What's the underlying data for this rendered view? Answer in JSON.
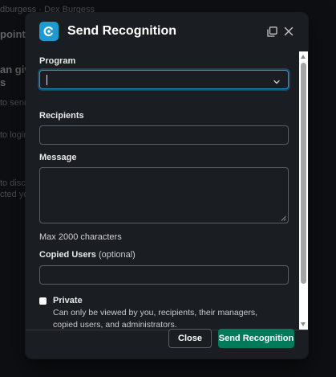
{
  "background": {
    "breadcrumb": "dburgess · Dex Burgess",
    "fragments": [
      "point",
      "an give",
      "s",
      "to send",
      "to login",
      "to disco",
      "cted you"
    ]
  },
  "modal": {
    "title": "Send Recognition",
    "app_icon": "recognition-app-icon",
    "header_icons": [
      "popout-icon",
      "close-icon"
    ]
  },
  "form": {
    "program": {
      "label": "Program",
      "value": ""
    },
    "recipients": {
      "label": "Recipients",
      "value": ""
    },
    "message": {
      "label": "Message",
      "value": "",
      "hint": "Max 2000 characters"
    },
    "copied_users": {
      "label": "Copied Users",
      "optional": "(optional)",
      "value": ""
    },
    "private": {
      "label": "Private",
      "checked": false,
      "description": "Can only be viewed by you, recipients, their managers, copied users, and administrators."
    }
  },
  "footer": {
    "close_label": "Close",
    "submit_label": "Send Recognition"
  },
  "colors": {
    "accent": "#1d9bd1",
    "primary_button": "#007a5a",
    "surface": "#1a1d21"
  }
}
